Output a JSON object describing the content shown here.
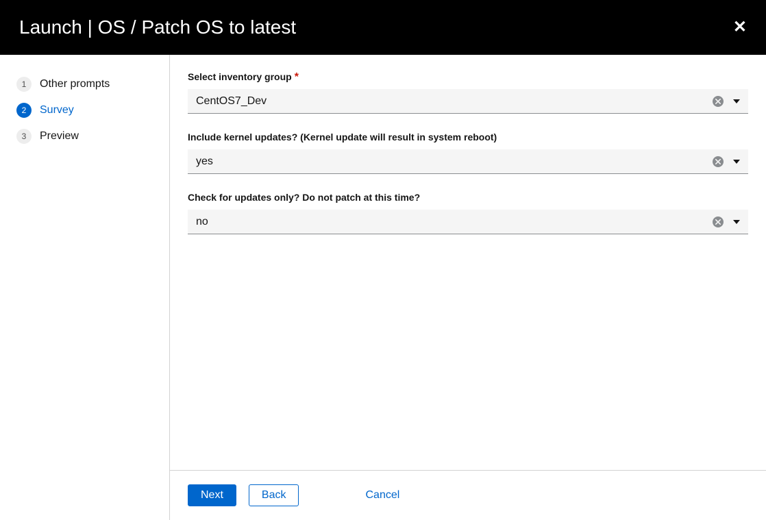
{
  "header": {
    "title": "Launch | OS / Patch OS to latest"
  },
  "steps": [
    {
      "number": "1",
      "label": "Other prompts"
    },
    {
      "number": "2",
      "label": "Survey"
    },
    {
      "number": "3",
      "label": "Preview"
    }
  ],
  "active_step_index": 1,
  "form": {
    "fields": [
      {
        "label": "Select inventory group",
        "required": true,
        "value": "CentOS7_Dev"
      },
      {
        "label": "Include kernel updates? (Kernel update will result in system reboot)",
        "required": false,
        "value": "yes"
      },
      {
        "label": "Check for updates only? Do not patch at this time?",
        "required": false,
        "value": "no"
      }
    ]
  },
  "footer": {
    "next": "Next",
    "back": "Back",
    "cancel": "Cancel"
  }
}
